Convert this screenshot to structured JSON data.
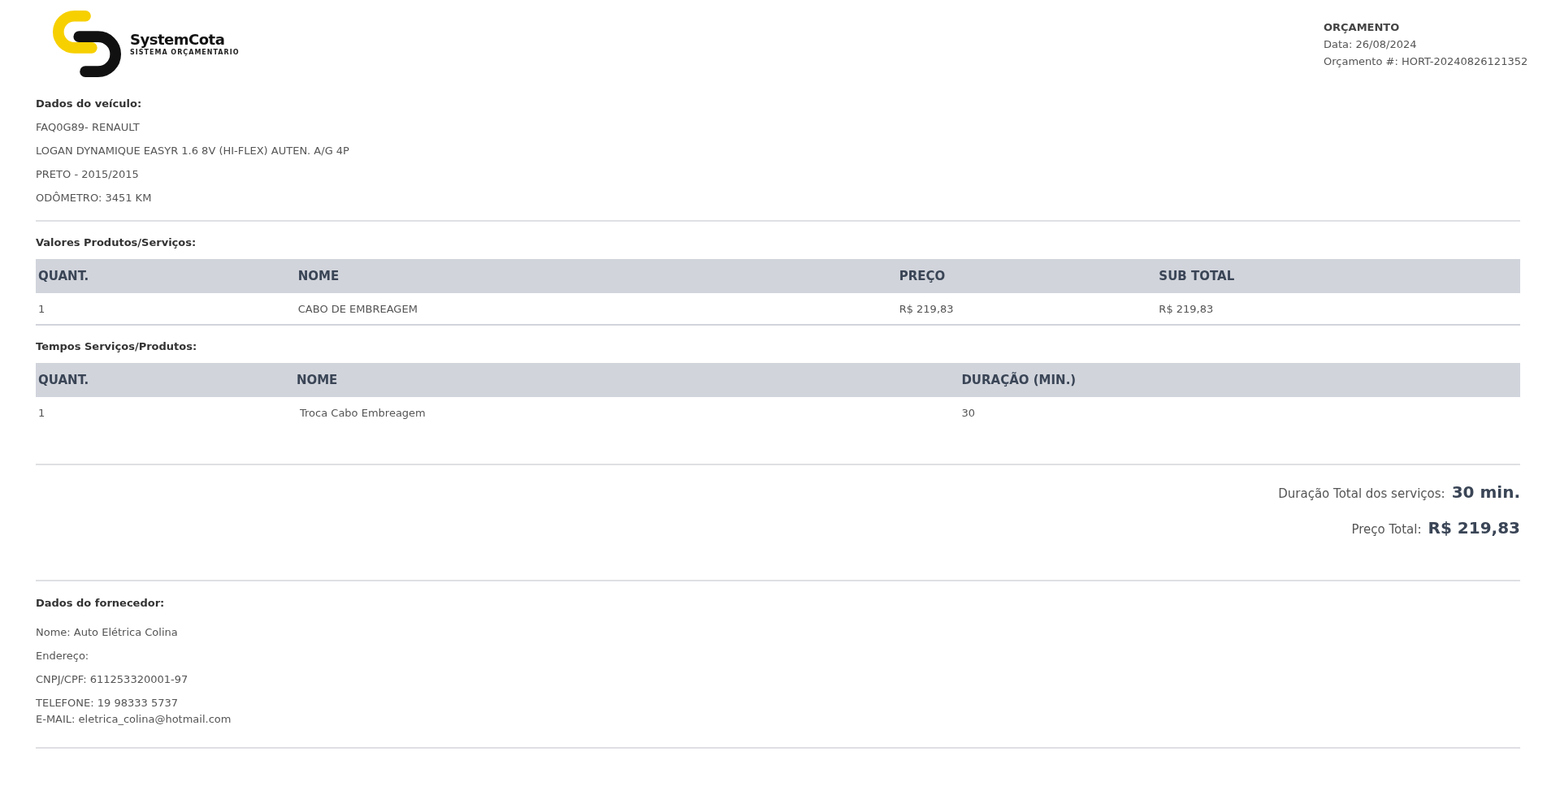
{
  "logo": {
    "name": "SystemCota",
    "tagline": "SISTEMA ORÇAMENTARIO"
  },
  "header": {
    "title": "ORÇAMENTO",
    "date": "Data: 26/08/2024",
    "number": "Orçamento #: HORT-20240826121352"
  },
  "vehicle": {
    "title": "Dados do veículo:",
    "lines": [
      "FAQ0G89- RENAULT",
      "LOGAN DYNAMIQUE EASYR 1.6 8V (HI-FLEX) AUTEN. A/G 4P",
      "PRETO - 2015/2015",
      "ODÔMETRO: 3451 KM"
    ]
  },
  "tables": [
    {
      "title": "Valores Produtos/Serviços:",
      "columns": [
        "QUANT.",
        "NOME",
        "PREÇO",
        "SUB TOTAL"
      ],
      "rows": [
        [
          "1",
          "CABO DE EMBREAGEM",
          "R$ 219,83",
          "R$ 219,83"
        ]
      ],
      "bordered": true
    },
    {
      "title": "Tempos Serviços/Produtos:",
      "columns": [
        "QUANT.",
        "NOME",
        "DURAÇÃO (MIN.)"
      ],
      "rows": [
        [
          "1",
          " Troca Cabo Embreagem",
          "30"
        ]
      ],
      "bordered": false
    }
  ],
  "totals": [
    {
      "label": "Duração Total dos serviços:",
      "value": "30 min."
    },
    {
      "label": "Preço Total:",
      "value": "R$ 219,83"
    }
  ],
  "supplier": {
    "title": "Dados do fornecedor:",
    "lines": [
      "Nome: Auto Elétrica Colina",
      "Endereço:",
      "CNPJ/CPF: 611253320001-97",
      "TELEFONE: 19 98333 5737"
    ],
    "email": "E-MAIL: eletrica_colina@hotmail.com"
  }
}
